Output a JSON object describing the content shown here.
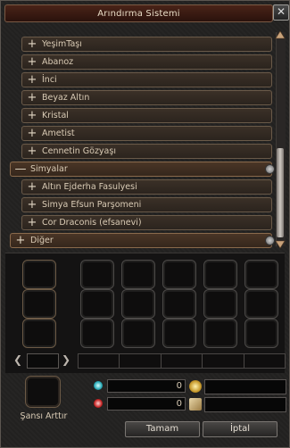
{
  "window": {
    "title": "Arındırma Sistemi",
    "close_glyph": "✕"
  },
  "list": {
    "items": [
      {
        "kind": "sub",
        "sign": "+",
        "label": "YeşimTaşı"
      },
      {
        "kind": "sub",
        "sign": "+",
        "label": "Abanoz"
      },
      {
        "kind": "sub",
        "sign": "+",
        "label": "İnci"
      },
      {
        "kind": "sub",
        "sign": "+",
        "label": "Beyaz Altın"
      },
      {
        "kind": "sub",
        "sign": "+",
        "label": "Kristal"
      },
      {
        "kind": "sub",
        "sign": "+",
        "label": "Ametist"
      },
      {
        "kind": "sub",
        "sign": "+",
        "label": "Cennetin Gözyaşı"
      },
      {
        "kind": "cat",
        "sign": "—",
        "label": "Simyalar"
      },
      {
        "kind": "sub",
        "sign": "+",
        "label": "Altın Ejderha Fasulyesi"
      },
      {
        "kind": "sub",
        "sign": "+",
        "label": "Simya Efsun Parşomeni"
      },
      {
        "kind": "sub",
        "sign": "+",
        "label": "Cor Draconis (efsanevi)"
      },
      {
        "kind": "cat",
        "sign": "+",
        "label": "Diğer"
      }
    ]
  },
  "nav": {
    "prev": "❮",
    "next": "❯"
  },
  "luck": {
    "label": "Şansı Arttır"
  },
  "costs": {
    "gem_blue_value": "0",
    "gem_red_value": "0"
  },
  "buttons": {
    "ok": "Tamam",
    "cancel": "İptal"
  },
  "colors": {
    "accent": "#8a6a4c",
    "background": "#232221"
  }
}
